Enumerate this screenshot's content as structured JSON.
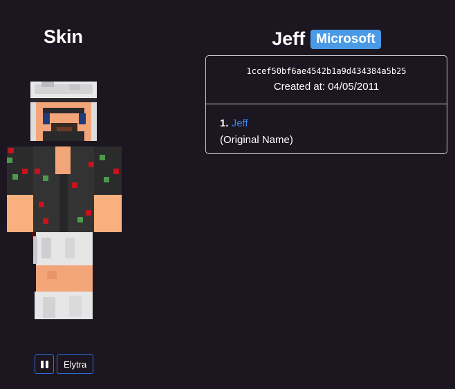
{
  "skin_section": {
    "title": "Skin",
    "controls": {
      "pause_icon": "pause-icon",
      "elytra_label": "Elytra"
    }
  },
  "profile": {
    "name": "Jeff",
    "badge": "Microsoft",
    "uuid": "1ccef50bf6ae4542b1a9d434384a5b25",
    "created": "Created at: 04/05/2011",
    "name_history": [
      {
        "number": "1.",
        "name": "Jeff",
        "note": "(Original Name)"
      }
    ]
  },
  "colors": {
    "background": "#1b1620",
    "badge": "#4a9ae6",
    "link": "#3b82f6",
    "button_border": "#2f6fdb"
  }
}
